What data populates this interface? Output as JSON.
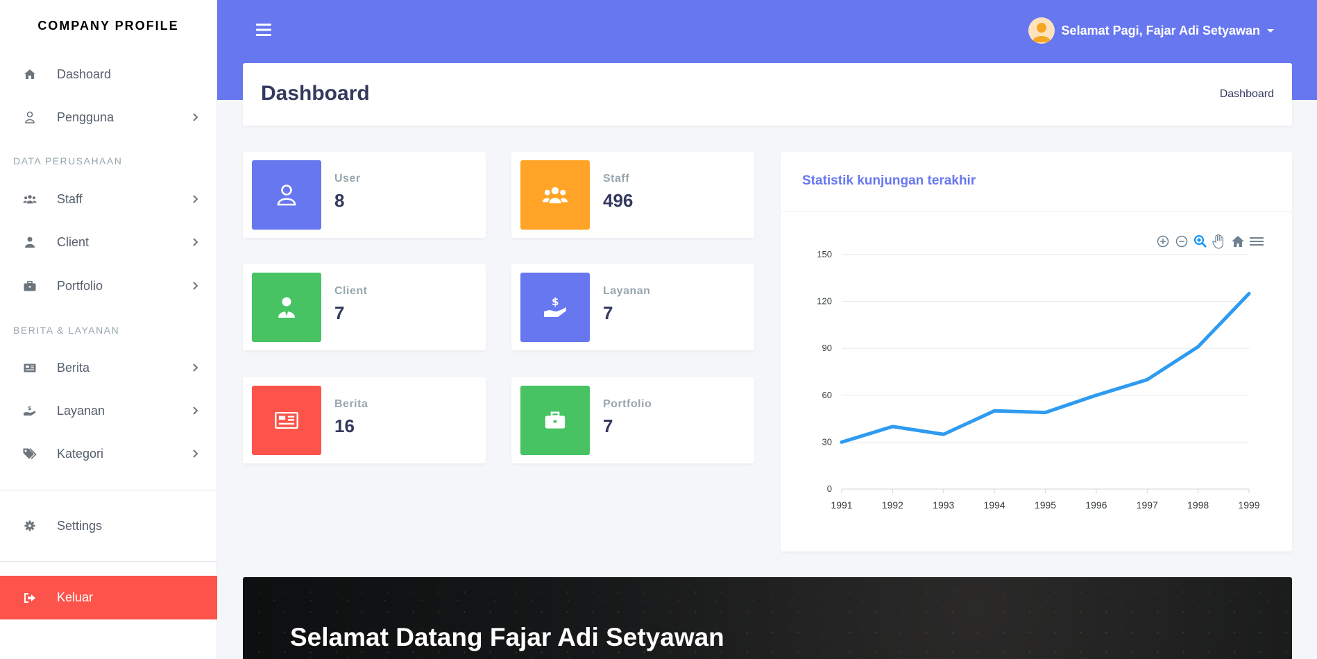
{
  "brand": "COMPANY PROFILE",
  "sidebar": {
    "items": [
      {
        "label": "Dashoard",
        "icon": "home-icon"
      },
      {
        "label": "Pengguna",
        "icon": "user-icon"
      },
      {
        "label": "Staff",
        "icon": "users-icon"
      },
      {
        "label": "Client",
        "icon": "user-tie-icon"
      },
      {
        "label": "Portfolio",
        "icon": "briefcase-icon"
      },
      {
        "label": "Berita",
        "icon": "newspaper-icon"
      },
      {
        "label": "Layanan",
        "icon": "hand-holding-icon"
      },
      {
        "label": "Kategori",
        "icon": "tags-icon"
      },
      {
        "label": "Settings",
        "icon": "gear-icon"
      },
      {
        "label": "Keluar",
        "icon": "logout-icon"
      }
    ],
    "sections": [
      "DATA PERUSAHAAN",
      "BERITA & LAYANAN"
    ]
  },
  "topbar": {
    "greeting": "Selamat Pagi, Fajar Adi Setyawan",
    "color": "#6777ef"
  },
  "header": {
    "title": "Dashboard",
    "breadcrumb": "Dashboard"
  },
  "stats": [
    {
      "label": "User",
      "value": "8",
      "color": "#6777ef",
      "icon": "user-icon"
    },
    {
      "label": "Staff",
      "value": "496",
      "color": "#ffa426",
      "icon": "users-icon"
    },
    {
      "label": "Client",
      "value": "7",
      "color": "#47c363",
      "icon": "user-tie-icon"
    },
    {
      "label": "Layanan",
      "value": "7",
      "color": "#6777ef",
      "icon": "hand-holding-dollar-icon"
    },
    {
      "label": "Berita",
      "value": "16",
      "color": "#fc544b",
      "icon": "newspaper-icon"
    },
    {
      "label": "Portfolio",
      "value": "7",
      "color": "#47c363",
      "icon": "briefcase-icon"
    }
  ],
  "chart": {
    "title": "Statistik kunjungan terakhir",
    "toolbar": [
      "zoom-in-icon",
      "zoom-out-icon",
      "zoom-select-icon",
      "pan-icon",
      "reset-home-icon",
      "menu-icon"
    ]
  },
  "chart_data": {
    "type": "line",
    "x": [
      "1991",
      "1992",
      "1993",
      "1994",
      "1995",
      "1996",
      "1997",
      "1998",
      "1999"
    ],
    "series": [
      {
        "values": [
          30,
          40,
          35,
          50,
          49,
          60,
          70,
          91,
          125
        ],
        "color": "#2e9bf0"
      }
    ],
    "ylim": [
      0,
      150
    ],
    "yticks": [
      0,
      30,
      60,
      90,
      120,
      150
    ],
    "grid": true
  },
  "banner": {
    "title": "Selamat Datang Fajar Adi Setyawan"
  }
}
